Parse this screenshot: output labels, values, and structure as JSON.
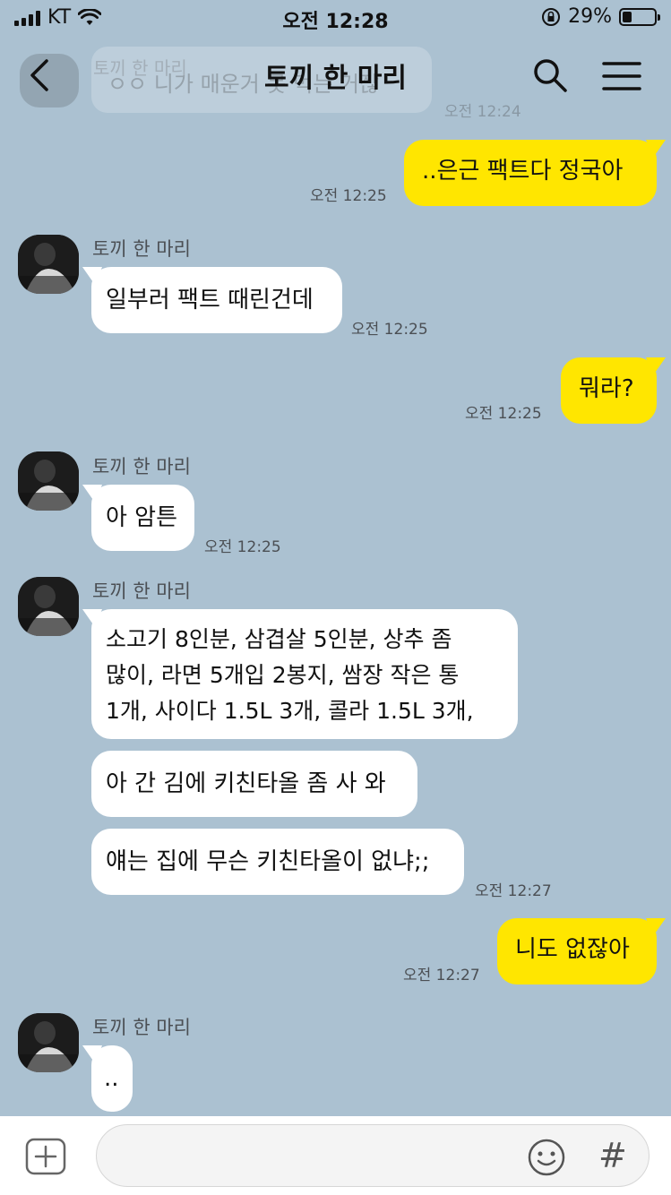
{
  "status": {
    "carrier": "KT",
    "time": "오전 12:28",
    "battery": "29%",
    "battery_level": 0.29
  },
  "header": {
    "title": "토끼 한 마리"
  },
  "ghost": {
    "name": "토끼 한 마리",
    "message": "ㅇㅇ 니가 매운거 못 먹는 거잖",
    "time": "오전 12:24"
  },
  "messages": {
    "m1": {
      "text": "..은근 팩트다 정국아",
      "time": "오전 12:25"
    },
    "m2": {
      "sender": "토끼 한 마리",
      "text": "일부러 팩트 때린건데",
      "time": "오전 12:25"
    },
    "m3": {
      "text": "뭐라?",
      "time": "오전 12:25"
    },
    "m4": {
      "sender": "토끼 한 마리",
      "text": "아 암튼",
      "time": "오전 12:25"
    },
    "m5": {
      "sender": "토끼 한 마리",
      "line1": "소고기 8인분, 삼겹살 5인분, 상추 좀",
      "line2": "많이, 라면 5개입 2봉지, 쌈장 작은 통",
      "line3": "1개, 사이다 1.5L 3개, 콜라 1.5L 3개,"
    },
    "m6": {
      "text": "아 간 김에 키친타올 좀 사 와"
    },
    "m7": {
      "text": "얘는 집에 무슨 키친타올이 없냐;;",
      "time": "오전 12:27"
    },
    "m8": {
      "text": "니도 없잖아",
      "time": "오전 12:27"
    },
    "m9": {
      "sender": "토끼 한 마리",
      "text": ".."
    }
  },
  "input": {
    "placeholder": ""
  },
  "icons": {
    "back": "chevron-left-icon",
    "search": "search-icon",
    "menu": "hamburger-menu-icon",
    "plus": "plus-icon",
    "emoji": "emoji-icon",
    "hash": "hash-icon"
  },
  "colors": {
    "background": "#abc1d1",
    "outgoing_bubble": "#ffe600",
    "incoming_bubble": "#ffffff"
  }
}
